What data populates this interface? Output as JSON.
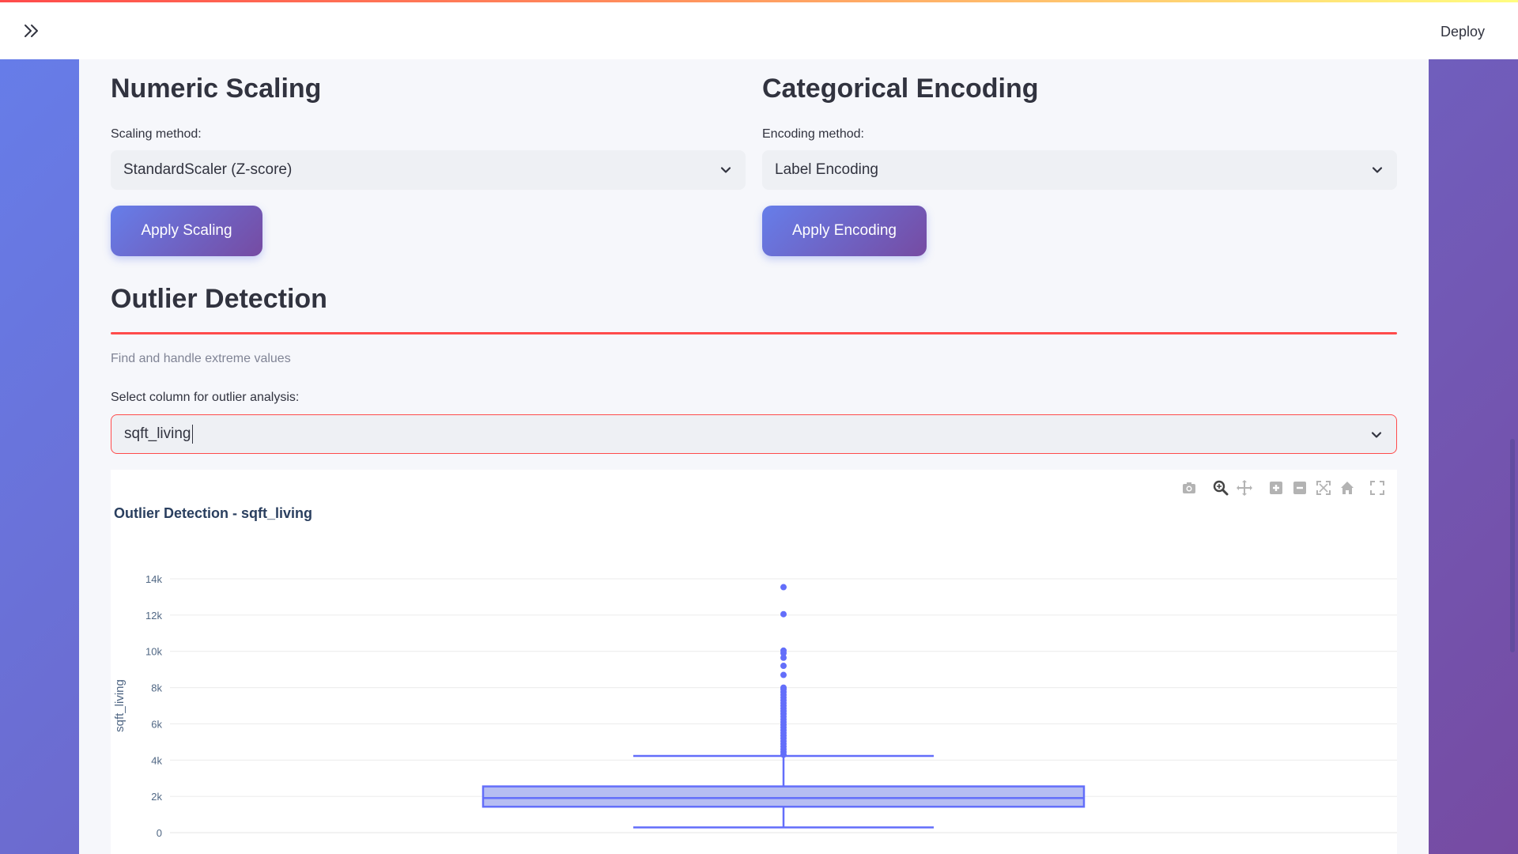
{
  "header": {
    "deploy_label": "Deploy",
    "sidebar_toggle_icon": "double-chevron-right-icon"
  },
  "scaling": {
    "title": "Numeric Scaling",
    "method_label": "Scaling method:",
    "method_value": "StandardScaler (Z-score)",
    "button_label": "Apply Scaling"
  },
  "encoding": {
    "title": "Categorical Encoding",
    "method_label": "Encoding method:",
    "method_value": "Label Encoding",
    "button_label": "Apply Encoding"
  },
  "outlier": {
    "title": "Outlier Detection",
    "caption": "Find and handle extreme values",
    "column_label": "Select column for outlier analysis:",
    "column_value": "sqft_living"
  },
  "modebar": [
    "camera-icon",
    "zoom-icon",
    "pan-icon",
    "zoom-in-icon",
    "zoom-out-icon",
    "autoscale-icon",
    "reset-axes-icon",
    "fullscreen-icon"
  ],
  "colors": {
    "accent_start": "#667eea",
    "accent_end": "#764ba2",
    "box_fill": "#a9b2f0",
    "box_line": "#636efa",
    "divider": "#ff4b4b"
  },
  "chart_data": {
    "type": "box",
    "title": "Outlier Detection - sqft_living",
    "ylabel": "sqft_living",
    "xlabel": "",
    "ylim": [
      0,
      14500
    ],
    "y_ticks": [
      0,
      2000,
      4000,
      6000,
      8000,
      10000,
      12000,
      14000
    ],
    "y_tick_labels": [
      "0",
      "2k",
      "4k",
      "6k",
      "8k",
      "10k",
      "12k",
      "14k"
    ],
    "grid": true,
    "box": {
      "min": 290,
      "q1": 1430,
      "median": 1910,
      "q3": 2550,
      "upper_fence": 4230
    },
    "outliers": [
      4300,
      4450,
      4600,
      4750,
      4900,
      5050,
      5200,
      5350,
      5500,
      5650,
      5800,
      5950,
      6100,
      6250,
      6400,
      6550,
      6700,
      6850,
      7000,
      7150,
      7300,
      7450,
      7600,
      7750,
      7900,
      8000,
      8700,
      9200,
      9650,
      9900,
      10040,
      12050,
      13540
    ]
  }
}
